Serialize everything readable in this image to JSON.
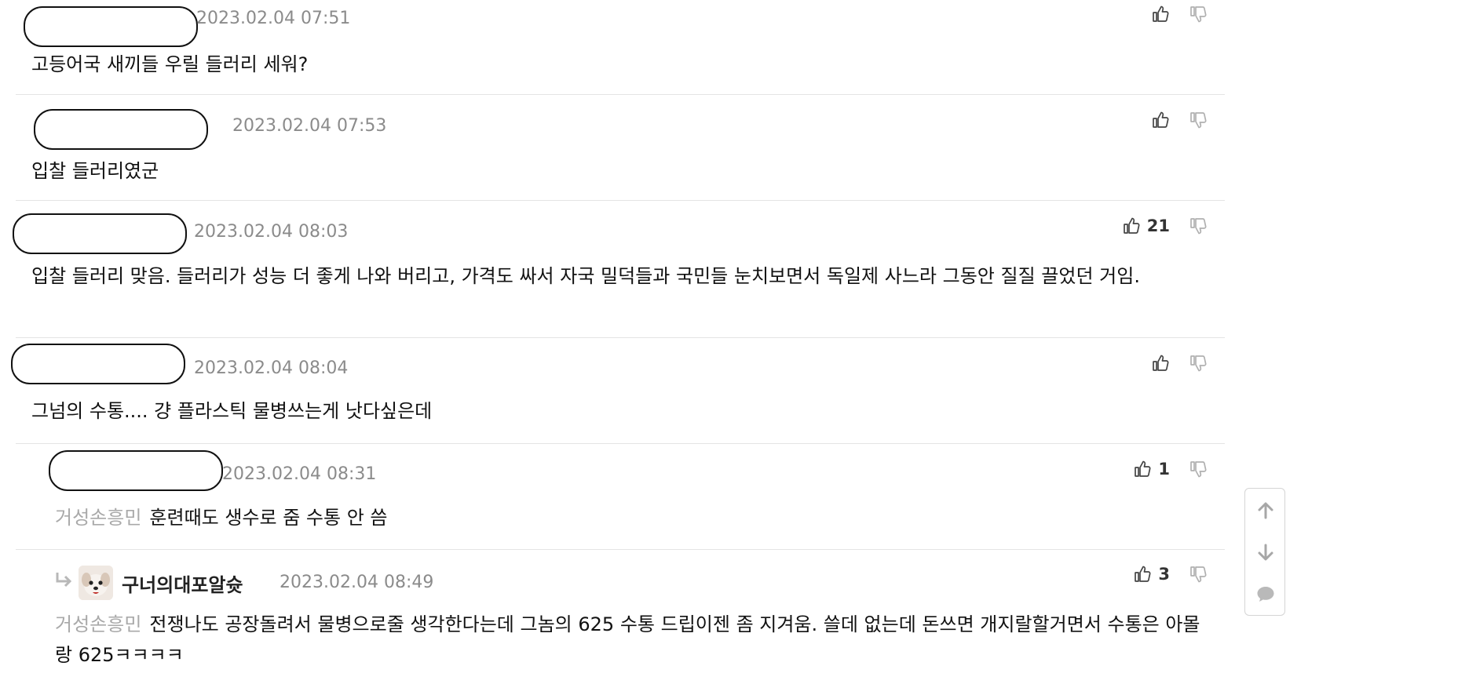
{
  "comments": [
    {
      "date": "2023.02.04 07:51",
      "text": "고등어국 새끼들 우릴 들러리 세워?",
      "likes": ""
    },
    {
      "date": "2023.02.04 07:53",
      "text": "입찰 들러리였군",
      "likes": ""
    },
    {
      "date": "2023.02.04 08:03",
      "text": "입찰 들러리 맞음. 들러리가 성능 더 좋게 나와 버리고, 가격도 싸서 자국 밀덕들과 국민들 눈치보면서 독일제 사느라 그동안 질질 끌었던 거임.",
      "likes": "21"
    },
    {
      "date": "2023.02.04 08:04",
      "text": "그넘의 수통.... 걍 플라스틱 물병쓰는게 낫다싶은데",
      "likes": ""
    },
    {
      "date": "2023.02.04 08:31",
      "mention": "거성손흥민",
      "text": "훈련때도 생수로 줌 수통 안 씀",
      "likes": "1"
    },
    {
      "nickname": "구너의대포알슛",
      "date": "2023.02.04 08:49",
      "mention": "거성손흥민",
      "text": "전쟁나도 공장돌려서 물병으로줄 생각한다는데 그놈의 625 수통 드립이젠 좀 지겨움. 쓸데 없는데 돈쓰면 개지랄할거면서 수통은 아몰랑 625ㅋㅋㅋㅋ",
      "likes": "3"
    }
  ],
  "icons": {
    "like": "thumbs-up-icon",
    "dislike": "thumbs-down-icon",
    "reply": "reply-arrow-icon",
    "scroll_up": "arrow-up-icon",
    "scroll_down": "arrow-down-icon",
    "comment": "comment-icon"
  },
  "colors": {
    "date": "#8b8b8b",
    "mention": "#a9a9a9",
    "divider": "#e4e4e4",
    "icon": "#555555"
  }
}
